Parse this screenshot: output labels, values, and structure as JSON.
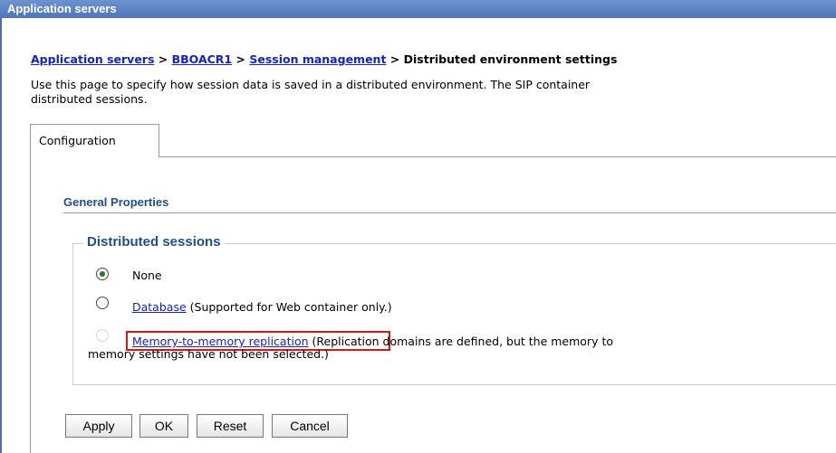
{
  "window": {
    "title": "Application servers"
  },
  "breadcrumb": {
    "items": [
      "Application servers",
      "BBOACR1",
      "Session management"
    ],
    "separator": ">",
    "current": "Distributed environment settings"
  },
  "description": {
    "line1": "Use this page to specify how session data is saved in a distributed environment. The SIP container",
    "line2": "distributed sessions."
  },
  "tabs": [
    {
      "label": "Configuration",
      "selected": true
    }
  ],
  "general_properties": {
    "heading": "General Properties"
  },
  "distributed_sessions": {
    "legend": "Distributed sessions",
    "options": [
      {
        "label": "None",
        "selected": true
      },
      {
        "link": "Database",
        "note": "(Supported for Web container only.)",
        "selected": false
      },
      {
        "link": "Memory-to-memory replication",
        "note": "(Replication domains are defined, but the memory to",
        "note2": "memory settings have not been selected.)",
        "selected": false,
        "disabled": true
      }
    ]
  },
  "buttons": {
    "apply": "Apply",
    "ok": "OK",
    "reset": "Reset",
    "cancel": "Cancel"
  }
}
